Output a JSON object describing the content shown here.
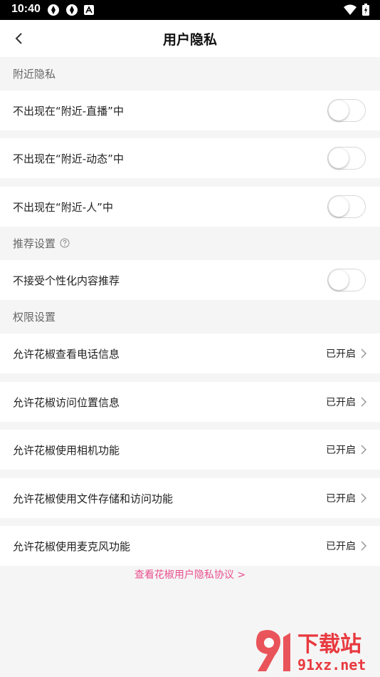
{
  "status_bar": {
    "time": "10:40"
  },
  "nav": {
    "title": "用户隐私"
  },
  "sections": {
    "nearby": {
      "title": "附近隐私"
    },
    "recommend": {
      "title": "推荐设置"
    },
    "permission": {
      "title": "权限设置"
    }
  },
  "toggles": [
    {
      "label": "不出现在“附近-直播”中",
      "on": false
    },
    {
      "label": "不出现在“附近-动态”中",
      "on": false
    },
    {
      "label": "不出现在“附近-人”中",
      "on": false
    },
    {
      "label": "不接受个性化内容推荐",
      "on": false
    }
  ],
  "permissions": [
    {
      "label": "允许花椒查看电话信息",
      "value": "已开启"
    },
    {
      "label": "允许花椒访问位置信息",
      "value": "已开启"
    },
    {
      "label": "允许花椒使用相机功能",
      "value": "已开启"
    },
    {
      "label": "允许花椒使用文件存储和访问功能",
      "value": "已开启"
    },
    {
      "label": "允许花椒使用麦克风功能",
      "value": "已开启"
    }
  ],
  "footer": {
    "link": "查看花椒用户隐私协议 >"
  },
  "watermark": {
    "big": "下载站",
    "site": "91xz.net"
  },
  "colors": {
    "accent": "#ea4f8e",
    "background": "#f5f5f5"
  }
}
